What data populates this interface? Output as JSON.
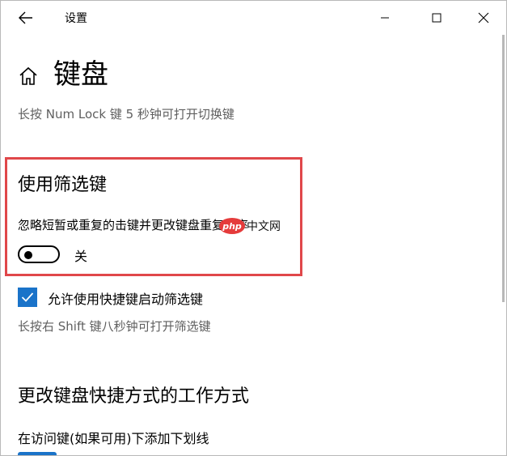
{
  "window": {
    "title": "设置"
  },
  "header": {
    "page_title": "键盘"
  },
  "sections": {
    "numlock_desc": "长按 Num Lock 键 5 秒钟可打开切换键",
    "filter_keys": {
      "heading": "使用筛选键",
      "description": "忽略短暂或重复的击键并更改键盘重复速率",
      "toggle_state": "off",
      "toggle_label": "关"
    },
    "shortcut_checkbox": {
      "checked": true,
      "label": "允许使用快捷键启动筛选键",
      "description": "长按右 Shift 键八秒钟可打开筛选键"
    },
    "shortcut_section": {
      "heading": "更改键盘快捷方式的工作方式",
      "underline_label": "在访问键(如果可用)下添加下划线"
    }
  },
  "watermark": {
    "logo_text": "php",
    "text": "中文网"
  },
  "colors": {
    "highlight_border": "#e0474a",
    "checkbox_accent": "#1a73c9",
    "secondary_text": "#5f5f5f"
  },
  "icons": {
    "back": "arrow-left-icon",
    "minimize": "minimize-icon",
    "maximize": "maximize-icon",
    "close": "close-icon",
    "home": "home-icon",
    "check": "checkmark-icon"
  }
}
